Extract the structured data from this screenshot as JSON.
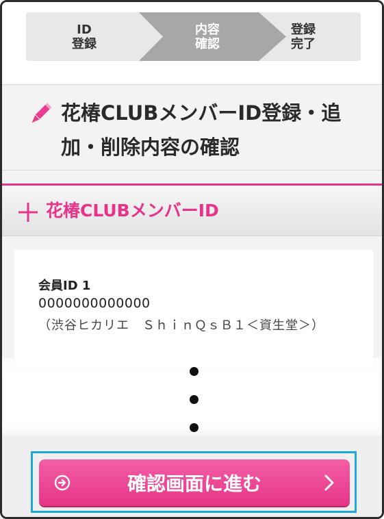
{
  "stepper": {
    "steps": [
      {
        "label": "ID\n登録"
      },
      {
        "label": "内容\n確認"
      },
      {
        "label": "登録\n完了"
      }
    ],
    "active_index": 1
  },
  "title": {
    "text": "花椿CLUBメンバーID登録・追加・削除内容の確認",
    "icon": "pencil-icon"
  },
  "section": {
    "title": "花椿CLUBメンバーID",
    "icon": "plus-icon"
  },
  "member": {
    "label": "会員ID 1",
    "id": "0000000000000",
    "store": "（渋谷ヒカリエ　ＳｈｉｎＱｓＢ１＜資生堂＞）"
  },
  "button": {
    "label": "確認画面に進む",
    "left_icon": "arrow-circle-icon",
    "right_icon": "chevron-right-icon"
  },
  "colors": {
    "accent": "#e8338a",
    "highlight": "#1fa9d8",
    "stepper_active": "#a7a7a7"
  }
}
